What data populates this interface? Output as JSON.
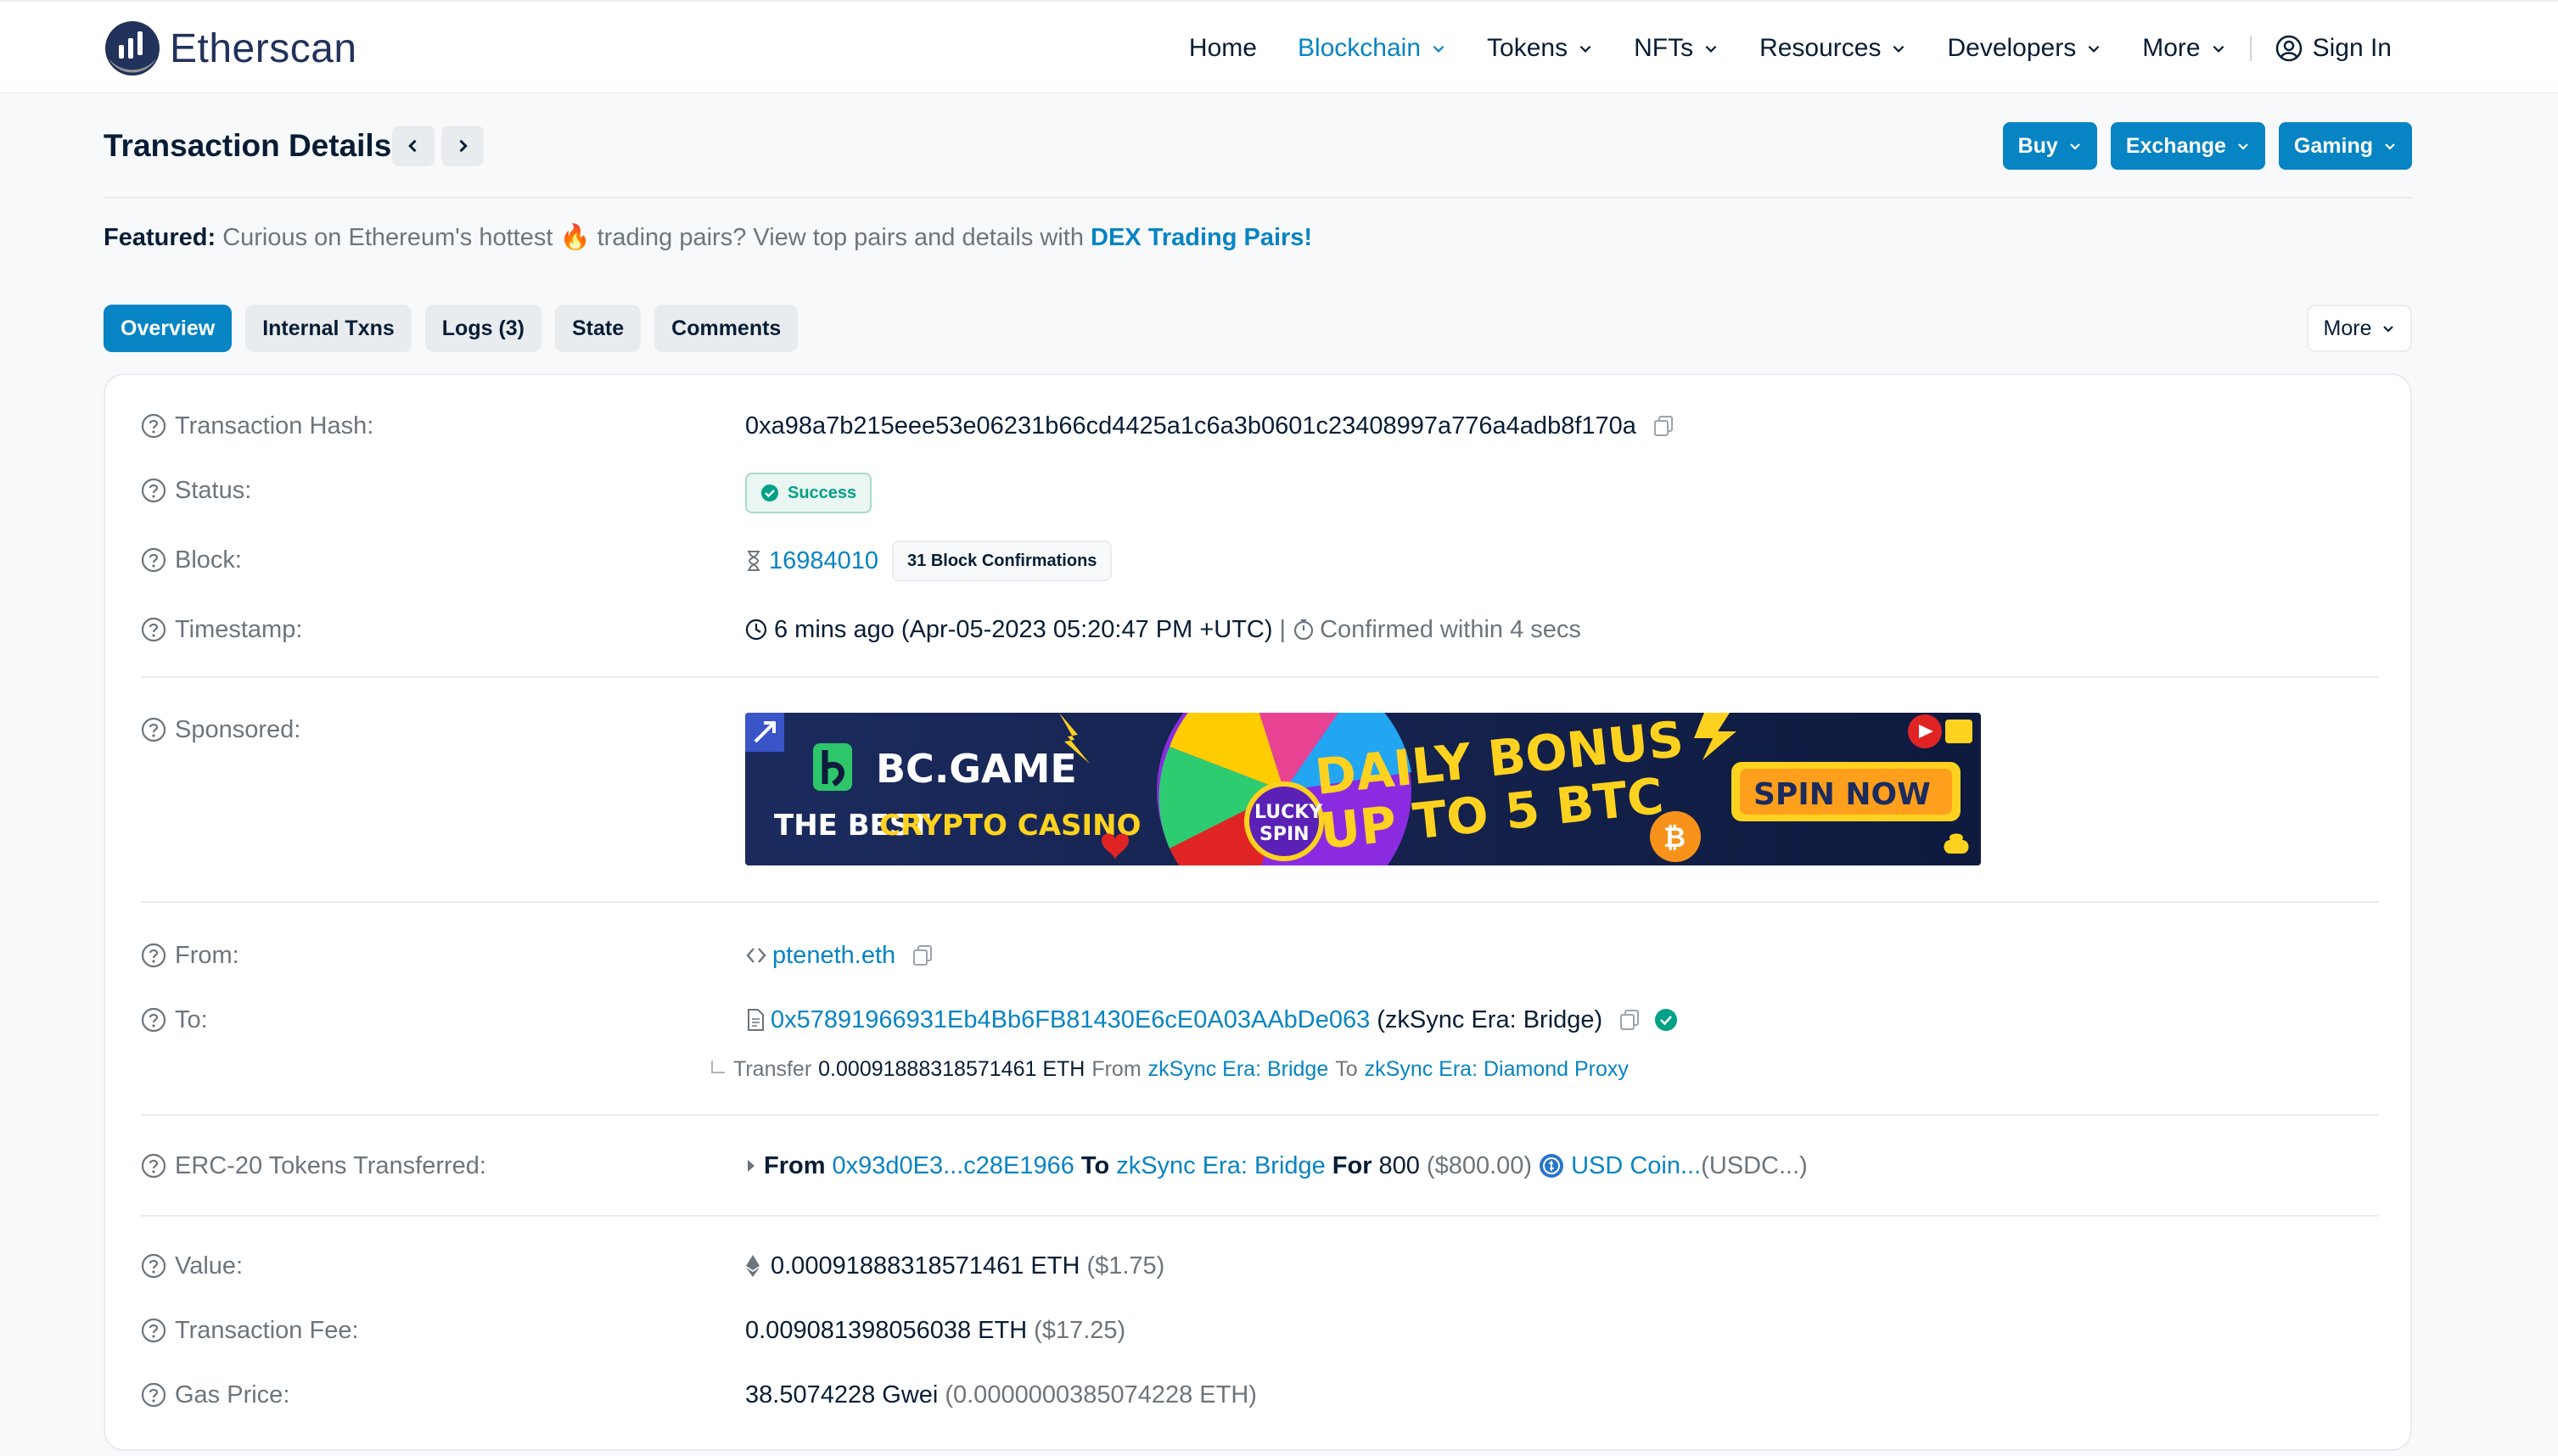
{
  "header": {
    "logo_text": "Etherscan",
    "nav": [
      {
        "label": "Home",
        "active": false,
        "dropdown": false
      },
      {
        "label": "Blockchain",
        "active": true,
        "dropdown": true
      },
      {
        "label": "Tokens",
        "active": false,
        "dropdown": true
      },
      {
        "label": "NFTs",
        "active": false,
        "dropdown": true
      },
      {
        "label": "Resources",
        "active": false,
        "dropdown": true
      },
      {
        "label": "Developers",
        "active": false,
        "dropdown": true
      },
      {
        "label": "More",
        "active": false,
        "dropdown": true
      }
    ],
    "signin_label": "Sign In"
  },
  "page": {
    "title": "Transaction Details",
    "buttons": [
      "Buy",
      "Exchange",
      "Gaming"
    ]
  },
  "featured": {
    "label": "Featured:",
    "text": " Curious on Ethereum's hottest ",
    "emoji": "🔥",
    "text2": " trading pairs? View top pairs and details with ",
    "link": "DEX Trading Pairs!"
  },
  "tabs": [
    {
      "label": "Overview",
      "active": true
    },
    {
      "label": "Internal Txns",
      "active": false
    },
    {
      "label": "Logs (3)",
      "active": false
    },
    {
      "label": "State",
      "active": false
    },
    {
      "label": "Comments",
      "active": false
    }
  ],
  "more_label": "More",
  "details": {
    "hash_label": "Transaction Hash:",
    "hash": "0xa98a7b215eee53e06231b66cd4425a1c6a3b0601c23408997a776a4adb8f170a",
    "status_label": "Status:",
    "status": "Success",
    "block_label": "Block:",
    "block": "16984010",
    "confirmations": "31 Block Confirmations",
    "timestamp_label": "Timestamp:",
    "timestamp": "6 mins ago (Apr-05-2023 05:20:47 PM +UTC)",
    "confirmed_within": "Confirmed within 4 secs",
    "sponsored_label": "Sponsored:",
    "from_label": "From:",
    "from": "pteneth.eth",
    "to_label": "To:",
    "to_address": "0x57891966931Eb4Bb6FB81430E6cE0A03AAbDe063",
    "to_name": "(zkSync Era: Bridge)",
    "transfer": {
      "prefix": "Transfer",
      "amount": "0.00091888318571461 ETH",
      "from_word": "From",
      "from": "zkSync Era: Bridge",
      "to_word": "To",
      "to": "zkSync Era: Diamond Proxy"
    },
    "erc20_label": "ERC-20 Tokens Transferred:",
    "erc20": {
      "from_word": "From",
      "from": "0x93d0E3...c28E1966",
      "to_word": "To",
      "to": "zkSync Era: Bridge",
      "for_word": "For",
      "amount": "800",
      "usd": "($800.00)",
      "token": "USD Coin...",
      "symbol": "(USDC...)"
    },
    "value_label": "Value:",
    "value": "0.00091888318571461 ETH",
    "value_usd": "($1.75)",
    "fee_label": "Transaction Fee:",
    "fee": "0.009081398056038 ETH",
    "fee_usd": "($17.25)",
    "gas_label": "Gas Price:",
    "gas": "38.5074228 Gwei",
    "gas_eth": "(0.0000000385074228 ETH)"
  },
  "banner": {
    "brand": "BC.GAME",
    "tagline_a": "THE BEST",
    "tagline_b": "CRYPTO CASINO",
    "headline_1": "DAILY BONUS",
    "headline_2": "UP TO 5 BTC",
    "cta": "SPIN NOW",
    "wheel_center_1": "LUCKY",
    "wheel_center_2": "SPIN"
  },
  "colors": {
    "accent": "#0784c3",
    "success": "#00a186",
    "text": "#081d35",
    "muted": "#6c757d"
  }
}
